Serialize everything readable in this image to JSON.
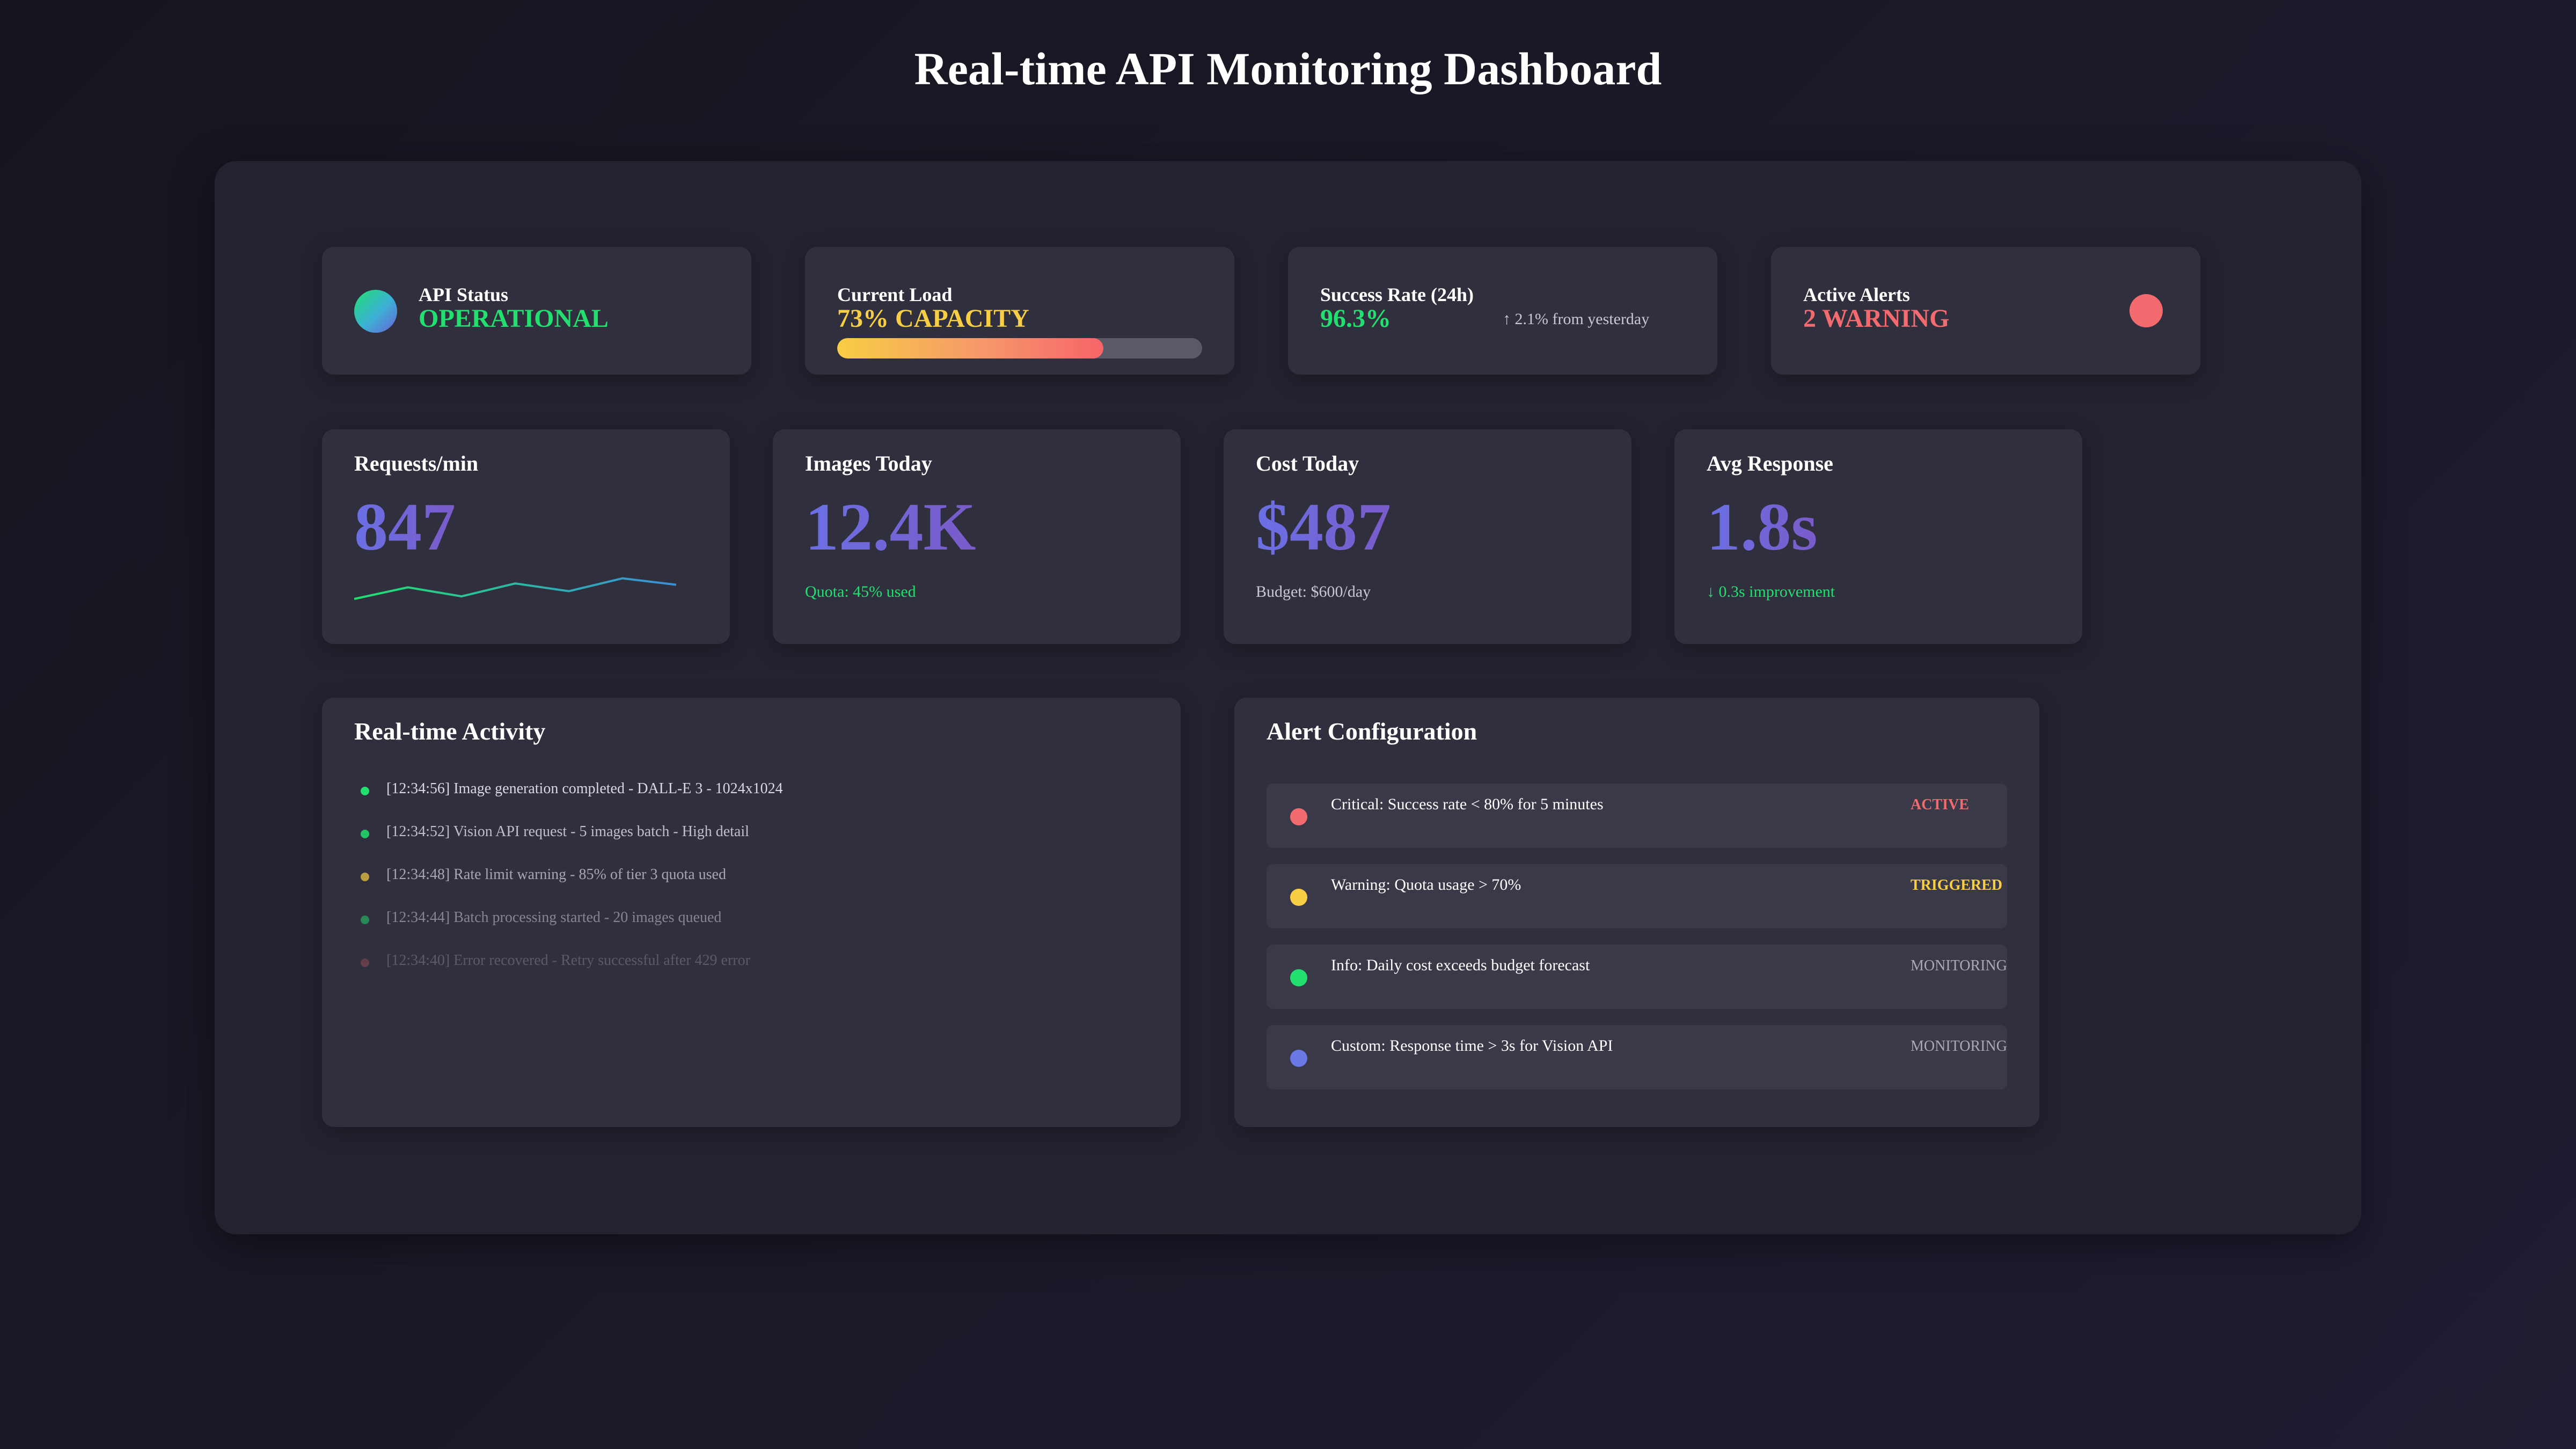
{
  "page": {
    "title": "Real-time API Monitoring Dashboard"
  },
  "status_cards": {
    "api_status": {
      "label": "API Status",
      "value": "OPERATIONAL",
      "color": "#22e06f"
    },
    "current_load": {
      "label": "Current Load",
      "value": "73% CAPACITY",
      "color": "#f8ce45",
      "percent": 73
    },
    "success_rate": {
      "label": "Success Rate (24h)",
      "value": "96.3%",
      "color": "#22e06f",
      "trend": "↑ 2.1% from yesterday"
    },
    "active_alerts": {
      "label": "Active Alerts",
      "value": "2 WARNING",
      "color": "#f46b6f"
    }
  },
  "metrics": {
    "requests": {
      "label": "Requests/min",
      "value": "847",
      "sparkline": [
        0,
        0.45,
        0.1,
        0.6,
        0.3,
        0.8,
        0.55
      ]
    },
    "images": {
      "label": "Images Today",
      "value": "12.4K",
      "sub": "Quota: 45% used",
      "sub_color": "#22e06f"
    },
    "cost": {
      "label": "Cost Today",
      "value": "$487",
      "sub": "Budget: $600/day",
      "sub_color": "#c8c7d2"
    },
    "response": {
      "label": "Avg Response",
      "value": "1.8s",
      "sub": "↓ 0.3s improvement",
      "sub_color": "#22e06f"
    }
  },
  "activity": {
    "title": "Real-time Activity",
    "items": [
      {
        "text": "[12:34:56] Image generation completed - DALL-E 3 - 1024x1024",
        "color": "#22e06f",
        "opacity": 1.0
      },
      {
        "text": "[12:34:52] Vision API request - 5 images batch - High detail",
        "color": "#22e06f",
        "opacity": 0.85
      },
      {
        "text": "[12:34:48] Rate limit warning - 85% of tier 3 quota used",
        "color": "#f8ce45",
        "opacity": 0.7
      },
      {
        "text": "[12:34:44] Batch processing started - 20 images queued",
        "color": "#22e06f",
        "opacity": 0.5
      },
      {
        "text": "[12:34:40] Error recovered - Retry successful after 429 error",
        "color": "#f46b6f",
        "opacity": 0.25
      }
    ]
  },
  "alert_config": {
    "title": "Alert Configuration",
    "rules": [
      {
        "text": "Critical: Success rate < 80% for 5 minutes",
        "state": "ACTIVE",
        "dot_color": "#f46b6f",
        "state_color": "#f46b6f",
        "state_bold": true
      },
      {
        "text": "Warning: Quota usage > 70%",
        "state": "TRIGGERED",
        "dot_color": "#f8ce45",
        "state_color": "#f8ce45",
        "state_bold": true
      },
      {
        "text": "Info: Daily cost exceeds budget forecast",
        "state": "MONITORING",
        "dot_color": "#22e06f",
        "state_color": "#a9a8b4",
        "state_bold": false
      },
      {
        "text": "Custom: Response time > 3s for Vision API",
        "state": "MONITORING",
        "dot_color": "#6a78e6",
        "state_color": "#a9a8b4",
        "state_bold": false
      }
    ]
  }
}
